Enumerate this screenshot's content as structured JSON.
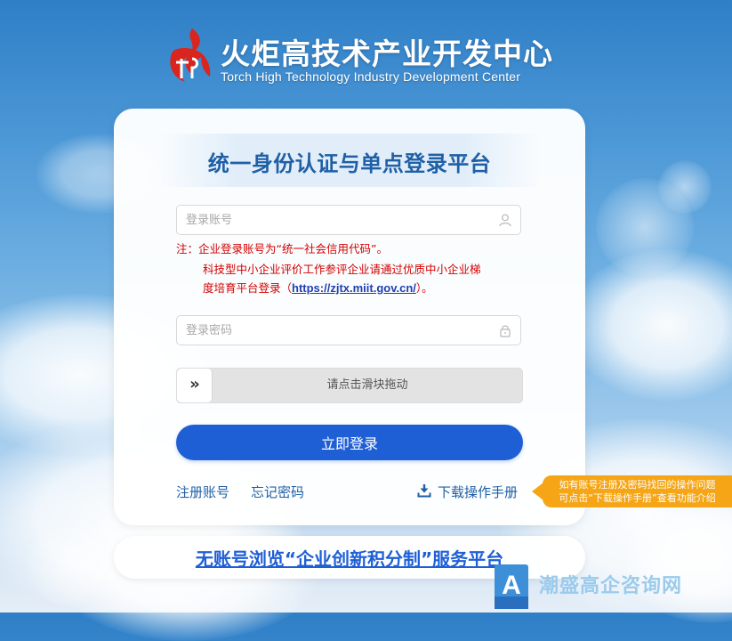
{
  "brand": {
    "name_cn": "火炬高技术产业开发中心",
    "name_en": "Torch High Technology Industry Development Center",
    "logo_icon": "torch-logo-icon",
    "logo_color": "#d9251d"
  },
  "login": {
    "title": "统一身份认证与单点登录平台",
    "account": {
      "placeholder": "登录账号",
      "value": "",
      "icon": "user-icon"
    },
    "note": {
      "line1": "注：企业登录账号为“统一社会信用代码”。",
      "line2": "科技型中小企业评价工作参评企业请通过优质中小企业梯",
      "line3_prefix": "度培育平台登录（",
      "link": "https://zjtx.miit.gov.cn/",
      "line3_suffix": "）。"
    },
    "password": {
      "placeholder": "登录密码",
      "value": "",
      "icon": "lock-icon"
    },
    "slider": {
      "handle_glyph": "»",
      "text": "请点击滑块拖动",
      "progress": 0
    },
    "submit_label": "立即登录",
    "register_label": "注册账号",
    "forgot_label": "忘记密码",
    "download_label": "下载操作手册",
    "download_icon": "download-icon"
  },
  "tooltip": {
    "line1": "如有账号注册及密码找回的操作问题",
    "line2": "可点击“下载操作手册”查看功能介绍"
  },
  "bottom": {
    "link_label": "无账号浏览“企业创新积分制”服务平台"
  },
  "watermark": {
    "text": "潮盛高企咨询网",
    "logo_letter": "A"
  },
  "colors": {
    "accent": "#1f5fd6",
    "title": "#1f5fa6",
    "note": "#d40000",
    "tooltip": "#f5a515"
  }
}
